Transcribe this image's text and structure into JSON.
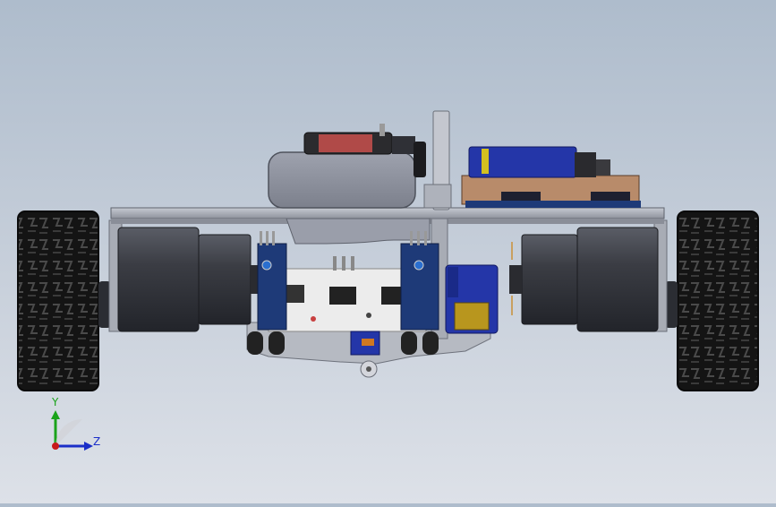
{
  "viewport": {
    "background_top": "#aebccc",
    "background_bottom": "#dde1e8"
  },
  "model": {
    "wheel_tread_color": "#1c1c1c",
    "motor_color": "#3e4047",
    "chassis_color": "#9ea2ad",
    "pcb_blue": "#1e3a78",
    "pcb_white": "#ececec",
    "battery_red": "#b04a48",
    "battery_blue": "#2436a8"
  },
  "triad": {
    "y_label": "Y",
    "z_label": "Z",
    "y_color": "#1aa31a",
    "z_color": "#1a2ec8",
    "x_color": "#c81a1a"
  }
}
